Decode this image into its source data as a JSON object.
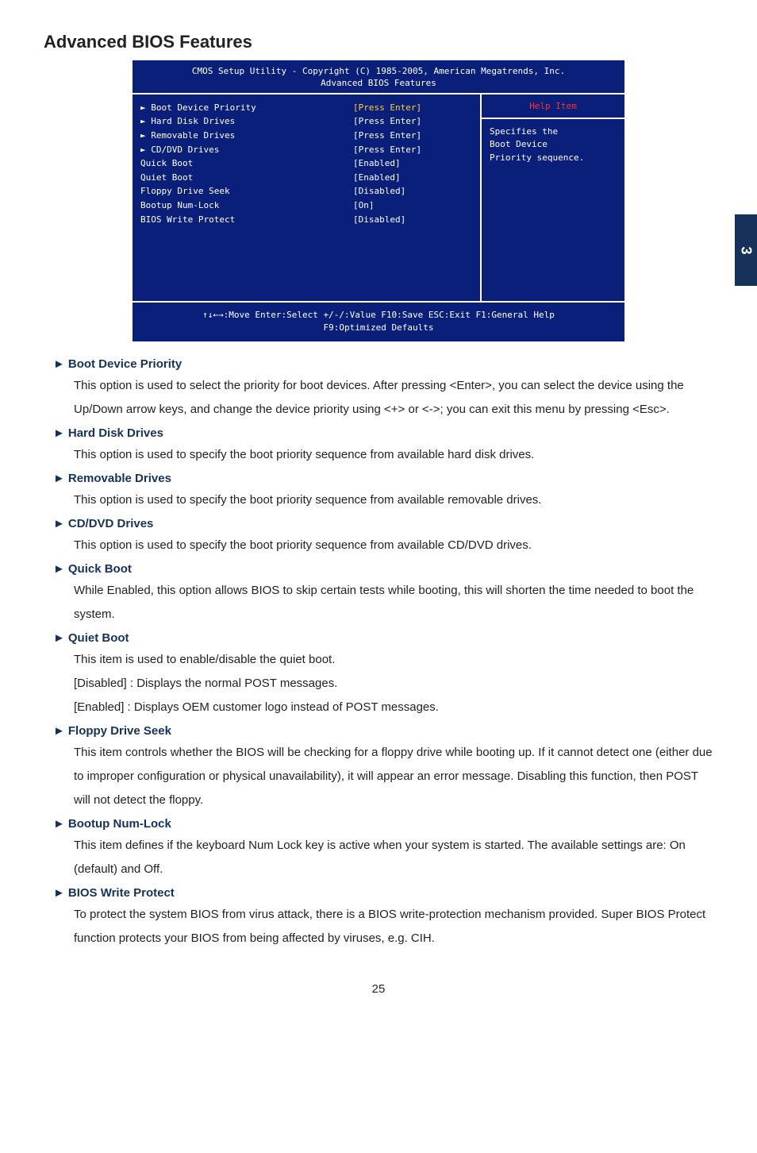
{
  "section_title": "Advanced BIOS Features",
  "side_tab": "3",
  "page_number": "25",
  "bios": {
    "header_line1": "CMOS Setup Utility - Copyright (C) 1985-2005, American Megatrends, Inc.",
    "header_line2": "Advanced BIOS Features",
    "rows": [
      {
        "name": "► Boot Device Priority",
        "value": "[Press Enter]",
        "value_yellow": true
      },
      {
        "name": "► Hard Disk Drives",
        "value": "[Press Enter]",
        "value_yellow": false
      },
      {
        "name": "► Removable Drives",
        "value": "[Press Enter]",
        "value_yellow": false
      },
      {
        "name": "► CD/DVD Drives",
        "value": "[Press Enter]",
        "value_yellow": false
      },
      {
        "name": "Quick Boot",
        "value": "[Enabled]",
        "value_yellow": false
      },
      {
        "name": "Quiet Boot",
        "value": "[Enabled]",
        "value_yellow": false
      },
      {
        "name": "Floppy Drive Seek",
        "value": "[Disabled]",
        "value_yellow": false
      },
      {
        "name": "Bootup Num-Lock",
        "value": "[On]",
        "value_yellow": false
      },
      {
        "name": "BIOS Write Protect",
        "value": "[Disabled]",
        "value_yellow": false
      }
    ],
    "help_title": "Help Item",
    "help_body": "Specifies the\nBoot Device\nPriority sequence.",
    "footer_line1": "↑↓←→:Move   Enter:Select    +/-/:Value   F10:Save   ESC:Exit    F1:General Help",
    "footer_line2": "F9:Optimized Defaults"
  },
  "descriptions": [
    {
      "title": "Boot Device Priority",
      "body": "This option is used to select the priority for boot devices. After pressing <Enter>, you can select the device using the Up/Down arrow keys, and change the device priority using <+> or <->; you can exit this menu by pressing <Esc>."
    },
    {
      "title": "Hard Disk Drives",
      "body": "This option is used to specify the boot priority sequence from available hard disk drives."
    },
    {
      "title": "Removable Drives",
      "body": "This option is used to specify the boot priority sequence from available removable drives."
    },
    {
      "title": "CD/DVD Drives",
      "body": "This option is used to specify the boot priority sequence from available CD/DVD drives."
    },
    {
      "title": "Quick Boot",
      "body": "While Enabled, this option allows BIOS to skip certain tests while booting, this will shorten the time needed to boot the system."
    },
    {
      "title": "Quiet Boot",
      "body": "This item is used to enable/disable the quiet boot.\n[Disabled] : Displays the normal POST messages.\n[Enabled] : Displays OEM customer logo instead of POST messages."
    },
    {
      "title": "Floppy Drive Seek",
      "body": "This item controls whether the BIOS will be checking for a floppy drive while booting up. If it cannot detect one (either due to improper configuration or physical unavailability), it will appear an error message. Disabling this function, then POST will not detect the floppy."
    },
    {
      "title": "Bootup Num-Lock",
      "body": "This item defines if the keyboard Num Lock key is active when your system is started. The available settings are: On (default) and Off."
    },
    {
      "title": "BIOS Write Protect",
      "body": "To protect the system BIOS from virus attack, there is a BIOS write-protection mechanism provided. Super BIOS Protect function protects your BIOS from being affected by viruses, e.g. CIH."
    }
  ]
}
